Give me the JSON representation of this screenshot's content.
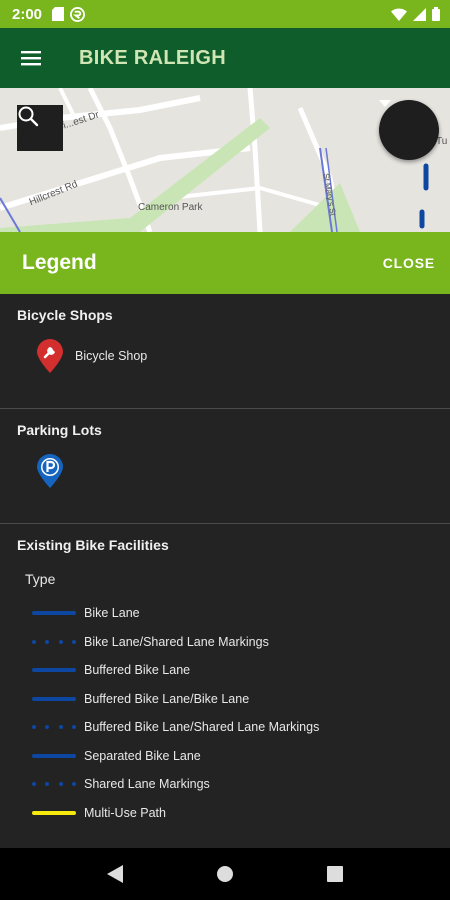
{
  "status_bar": {
    "time": "2:00"
  },
  "app_bar": {
    "title": "BIKE RALEIGH"
  },
  "map": {
    "labels": [
      "Bi...est Dr",
      "Hillcrest Rd",
      "Cameron Park",
      "St Mary's St",
      "Tu"
    ]
  },
  "legend": {
    "title": "Legend",
    "close_label": "CLOSE",
    "sections": {
      "shops": {
        "title": "Bicycle Shops",
        "item_label": "Bicycle Shop",
        "marker_color": "#d32f2f"
      },
      "parking": {
        "title": "Parking Lots",
        "item_label": "",
        "marker_color": "#1565c0"
      },
      "facilities": {
        "title": "Existing Bike Facilities",
        "type_label": "Type",
        "items": [
          {
            "label": "Bike Lane",
            "style": "solid",
            "color": "#0d47a1"
          },
          {
            "label": "Bike Lane/Shared Lane Markings",
            "style": "dotted",
            "color": "#0d47a1"
          },
          {
            "label": "Buffered Bike Lane",
            "style": "solid",
            "color": "#0d47a1"
          },
          {
            "label": "Buffered Bike Lane/Bike Lane",
            "style": "solid",
            "color": "#0d47a1"
          },
          {
            "label": "Buffered Bike Lane/Shared Lane Markings",
            "style": "dotted",
            "color": "#0d47a1"
          },
          {
            "label": "Separated Bike Lane",
            "style": "solid",
            "color": "#0d47a1"
          },
          {
            "label": "Shared Lane Markings",
            "style": "dotted",
            "color": "#0d47a1"
          },
          {
            "label": "Multi-Use Path",
            "style": "solid",
            "color": "#f5e90e"
          }
        ]
      }
    }
  },
  "colors": {
    "status_bar": "#79b51c",
    "app_bar": "#0e5d2b",
    "legend_header": "#79b51c",
    "panel": "#232323"
  }
}
